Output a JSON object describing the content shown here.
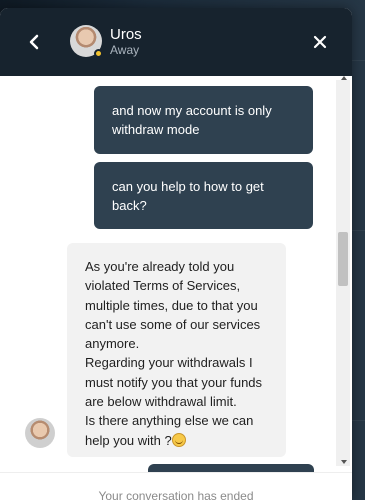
{
  "chat": {
    "agent_name": "Uros",
    "agent_status": "Away",
    "back_icon": "chevron-left-icon",
    "close_icon": "close-icon"
  },
  "messages": [
    {
      "direction": "out",
      "lines": [
        "and now my account is only",
        "withdraw mode"
      ]
    },
    {
      "direction": "out",
      "lines": [
        "can you help to how to get",
        "back?"
      ]
    },
    {
      "direction": "in",
      "lines": [
        "As you're already told you",
        "violated Terms of Services,",
        "multiple times, due to that you",
        "can't use some of our services",
        "anymore.",
        "Regarding your withdrawals I",
        "must notify you that your funds",
        "are below withdrawal limit.",
        "Is there anything else we can",
        "help you with ?"
      ],
      "emoji": "grinning-face"
    }
  ],
  "footer": {
    "ended_text": "Your conversation has ended"
  },
  "colors": {
    "header_bg": "#17232e",
    "outgoing_bubble": "#2f4150",
    "incoming_bubble": "#f2f2f2",
    "status_away": "#f2c22e"
  }
}
